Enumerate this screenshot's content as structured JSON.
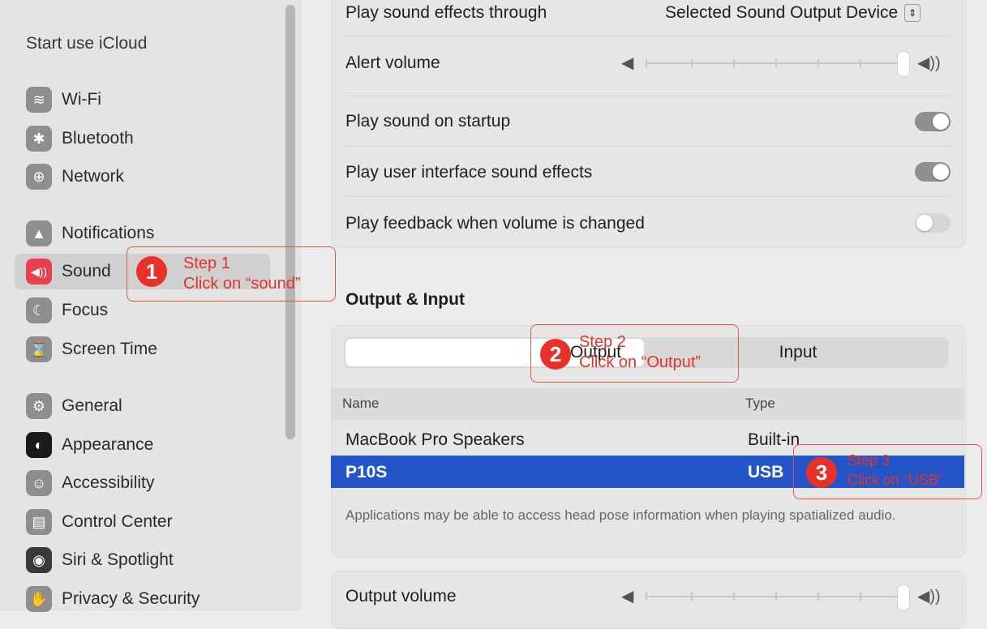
{
  "sidebar": {
    "title": "Start use iCloud",
    "items": [
      {
        "label": "Wi-Fi",
        "icon": "wifi-icon",
        "glyph": "≋"
      },
      {
        "label": "Bluetooth",
        "icon": "bluetooth-icon",
        "glyph": "✱"
      },
      {
        "label": "Network",
        "icon": "globe-icon",
        "glyph": "⊕"
      },
      {
        "label": "Notifications",
        "icon": "bell-icon",
        "glyph": "🔔"
      },
      {
        "label": "Sound",
        "icon": "speaker-icon",
        "glyph": "◀))"
      },
      {
        "label": "Focus",
        "icon": "moon-icon",
        "glyph": "☾"
      },
      {
        "label": "Screen Time",
        "icon": "hourglass-icon",
        "glyph": "⌛"
      },
      {
        "label": "General",
        "icon": "gear-icon",
        "glyph": "⚙"
      },
      {
        "label": "Appearance",
        "icon": "appearance-icon",
        "glyph": "◐"
      },
      {
        "label": "Accessibility",
        "icon": "accessibility-icon",
        "glyph": "♿"
      },
      {
        "label": "Control Center",
        "icon": "control-center-icon",
        "glyph": "▤"
      },
      {
        "label": "Siri & Spotlight",
        "icon": "siri-icon",
        "glyph": "◉"
      },
      {
        "label": "Privacy & Security",
        "icon": "hand-icon",
        "glyph": "✋"
      }
    ]
  },
  "sound": {
    "effects_through_label": "Play sound effects through",
    "effects_through_value": "Selected Sound Output Device",
    "alert_volume_label": "Alert volume",
    "alert_volume_level": 0.95,
    "startup_label": "Play sound on startup",
    "ui_effects_label": "Play user interface sound effects",
    "feedback_label": "Play feedback when volume is changed",
    "startup_on": true,
    "ui_effects_on": true,
    "feedback_on": false
  },
  "output_input": {
    "heading": "Output & Input",
    "tab_output": "Output",
    "tab_input": "Input",
    "col_name": "Name",
    "col_type": "Type",
    "devices": [
      {
        "name": "MacBook Pro Speakers",
        "type": "Built-in"
      },
      {
        "name": "P10S",
        "type": "USB"
      }
    ],
    "note": "Applications may be able to access head pose information when playing spatialized audio.",
    "output_volume_label": "Output volume",
    "output_volume_level": 0.95
  },
  "annotations": {
    "step1": {
      "num": "1",
      "line1": "Step 1",
      "line2": "Click on  “sound”"
    },
    "step2": {
      "num": "2",
      "line1": "Step 2",
      "line2": "Click on  “Output”"
    },
    "step3": {
      "num": "3",
      "line1": "Step 3",
      "line2": "Click on  “USB”"
    }
  },
  "colors": {
    "selection_blue": "#2455c8",
    "annotation_red": "#e63228",
    "sound_icon_red": "#e8404f"
  }
}
